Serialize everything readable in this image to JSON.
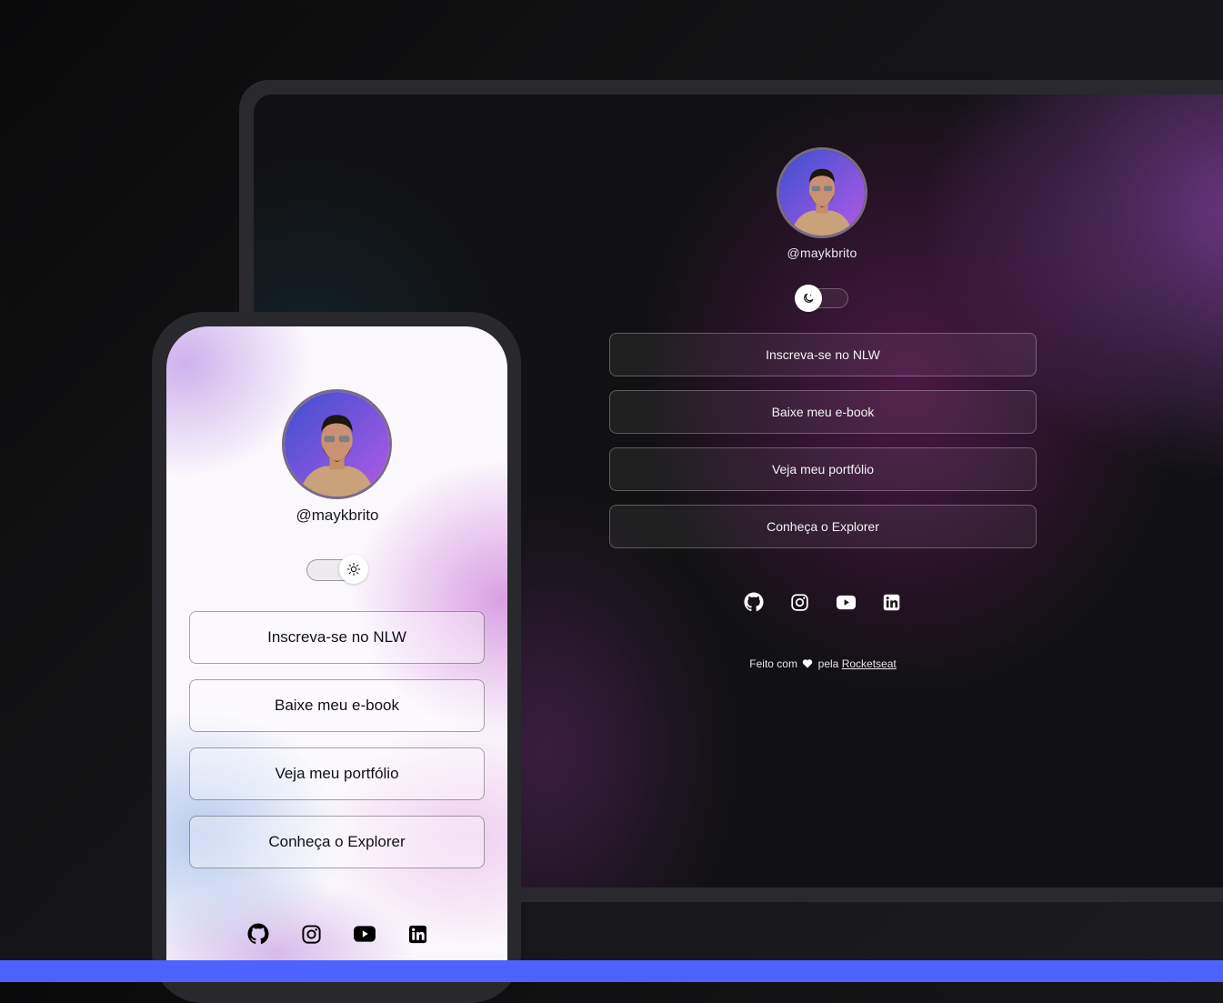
{
  "desktop": {
    "profile": {
      "handle": "@maykbrito",
      "avatar_icon": "person-avatar-icon"
    },
    "theme_toggle": {
      "state": "dark",
      "icon": "moon-icon"
    },
    "links": [
      {
        "label": "Inscreva-se no NLW"
      },
      {
        "label": "Baixe meu e-book"
      },
      {
        "label": "Veja meu portfólio"
      },
      {
        "label": "Conheça o Explorer"
      }
    ],
    "social": [
      "github-icon",
      "instagram-icon",
      "youtube-icon",
      "linkedin-icon"
    ],
    "footer": {
      "prefix": "Feito com",
      "heart": "heart-icon",
      "middle": "pela",
      "link_text": "Rocketseat"
    }
  },
  "mobile": {
    "profile": {
      "handle": "@maykbrito",
      "avatar_icon": "person-avatar-icon"
    },
    "theme_toggle": {
      "state": "light",
      "icon": "sun-icon"
    },
    "links": [
      {
        "label": "Inscreva-se no NLW"
      },
      {
        "label": "Baixe meu e-book"
      },
      {
        "label": "Veja meu portfólio"
      },
      {
        "label": "Conheça o Explorer"
      }
    ],
    "social": [
      "github-icon",
      "instagram-icon",
      "youtube-icon",
      "linkedin-icon"
    ]
  },
  "colors": {
    "accent_bar": "#4d63ff",
    "desktop_glow": "#7d3c96",
    "mobile_glow": "#d796e1"
  }
}
